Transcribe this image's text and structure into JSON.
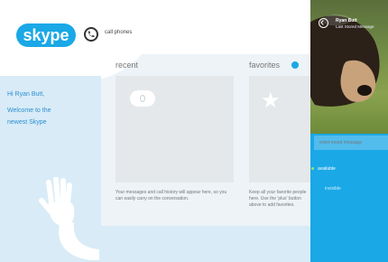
{
  "app": {
    "logo_text": "skype",
    "call_phones_label": "call phones"
  },
  "greeting": {
    "line1": "Hi Ryan Butt,",
    "line2": "Welcome to the",
    "line3": "newest Skype"
  },
  "recent": {
    "title": "recent",
    "description": "Your messages and call history will appear here, so you can easily carry on the conversation."
  },
  "favorites": {
    "title": "favorites",
    "description": "Keep all your favorite people here. Use the 'plus' button above to add favorites."
  },
  "profile": {
    "name": "Ryan Butt",
    "subtitle": "Last Stored Message",
    "mood_placeholder": "enter mood message",
    "status_options": [
      "available",
      "invisible"
    ],
    "current_status": "available"
  },
  "colors": {
    "brand": "#1aa8e6",
    "panel_light": "#d8ebf7",
    "greeting_text": "#2e8fd1",
    "available_dot": "#9be06b"
  },
  "icons": {
    "phone": "phone-icon",
    "back": "back-arrow-icon",
    "chat": "chat-bubble-icon",
    "star": "star-icon",
    "hand": "waving-hand-icon"
  }
}
